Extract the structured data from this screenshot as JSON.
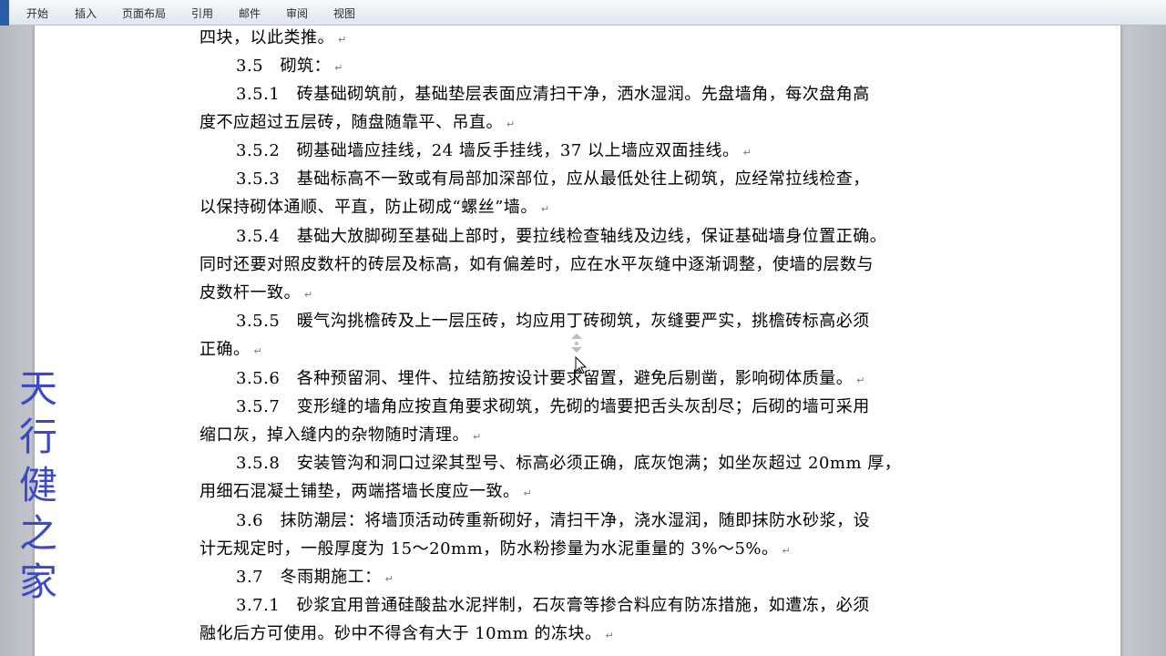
{
  "ribbon": {
    "tabs": [
      "开始",
      "插入",
      "页面布局",
      "引用",
      "邮件",
      "审阅",
      "视图"
    ]
  },
  "document": {
    "lines": [
      "四块，以此类推。",
      "3.5　砌筑：",
      "3.5.1　砖基础砌筑前，基础垫层表面应清扫干净，洒水湿润。先盘墙角，每次盘角高",
      "度不应超过五层砖，随盘随靠平、吊直。",
      "3.5.2　砌基础墙应挂线，24 墙反手挂线，37 以上墙应双面挂线。",
      "3.5.3　基础标高不一致或有局部加深部位，应从最低处往上砌筑，应经常拉线检查，",
      "以保持砌体通顺、平直，防止砌成“螺丝”墙。",
      "3.5.4　基础大放脚砌至基础上部时，要拉线检查轴线及边线，保证基础墙身位置正确。",
      "同时还要对照皮数杆的砖层及标高，如有偏差时，应在水平灰缝中逐渐调整，使墙的层数与",
      "皮数杆一致。",
      "3.5.5　暖气沟挑檐砖及上一层压砖，均应用丁砖砌筑，灰缝要严实，挑檐砖标高必须",
      "正确。",
      "3.5.6　各种预留洞、埋件、拉结筋按设计要求留置，避免后剔凿，影响砌体质量。",
      "3.5.7　变形缝的墙角应按直角要求砌筑，先砌的墙要把舌头灰刮尽；后砌的墙可采用",
      "缩口灰，掉入缝内的杂物随时清理。",
      "3.5.8　安装管沟和洞口过梁其型号、标高必须正确，底灰饱满；如坐灰超过 20mm 厚，",
      "用细石混凝土铺垫，两端搭墙长度应一致。",
      "3.6　抹防潮层：将墙顶活动砖重新砌好，清扫干净，浇水湿润，随即抹防水砂浆，设",
      "计无规定时，一般厚度为 15～20mm，防水粉掺量为水泥重量的 3%～5%。",
      "3.7　冬雨期施工：",
      "3.7.1　砂浆宜用普通硅酸盐水泥拌制，石灰膏等掺合料应有防冻措施，如遭冻，必须",
      "融化后方可使用。砂中不得含有大于 10mm 的冻块。"
    ],
    "paragraph_mark": "↵"
  },
  "watermark": {
    "text": "天\n行\n健\n之\n家"
  },
  "colors": {
    "watermark": "#3b49c9",
    "file_button": "#2a5ea8"
  }
}
